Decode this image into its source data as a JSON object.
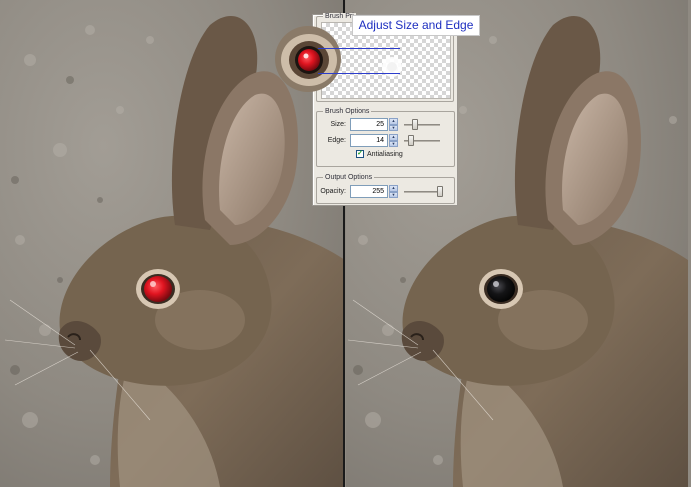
{
  "callout": {
    "text": "Adjust Size and Edge"
  },
  "dialog": {
    "preview_group_label": "Brush Pri",
    "brush_options": {
      "label": "Brush Options",
      "size": {
        "label": "Size:",
        "value": "25",
        "slider_fraction": 0.3
      },
      "edge": {
        "label": "Edge:",
        "value": "14",
        "slider_fraction": 0.2
      },
      "antialiasing": {
        "label": "Antialiasing",
        "checked": true
      }
    },
    "output_options": {
      "label": "Output Options",
      "opacity": {
        "label": "Opacity:",
        "value": "255",
        "slider_fraction": 1.0
      }
    }
  },
  "photos": {
    "before": {
      "eye_color": "#e01420",
      "description_icon": "red-eye-rabbit"
    },
    "after": {
      "eye_color": "#101012",
      "description_icon": "corrected-eye-rabbit"
    }
  },
  "colors": {
    "callout_text": "#1e2fc0",
    "guide_lines": "#2c3dcc",
    "dialog_bg": "#ece9e2"
  },
  "icons": {
    "spin_up": "up-arrow-icon",
    "spin_down": "down-arrow-icon",
    "check": "checkmark-icon"
  }
}
